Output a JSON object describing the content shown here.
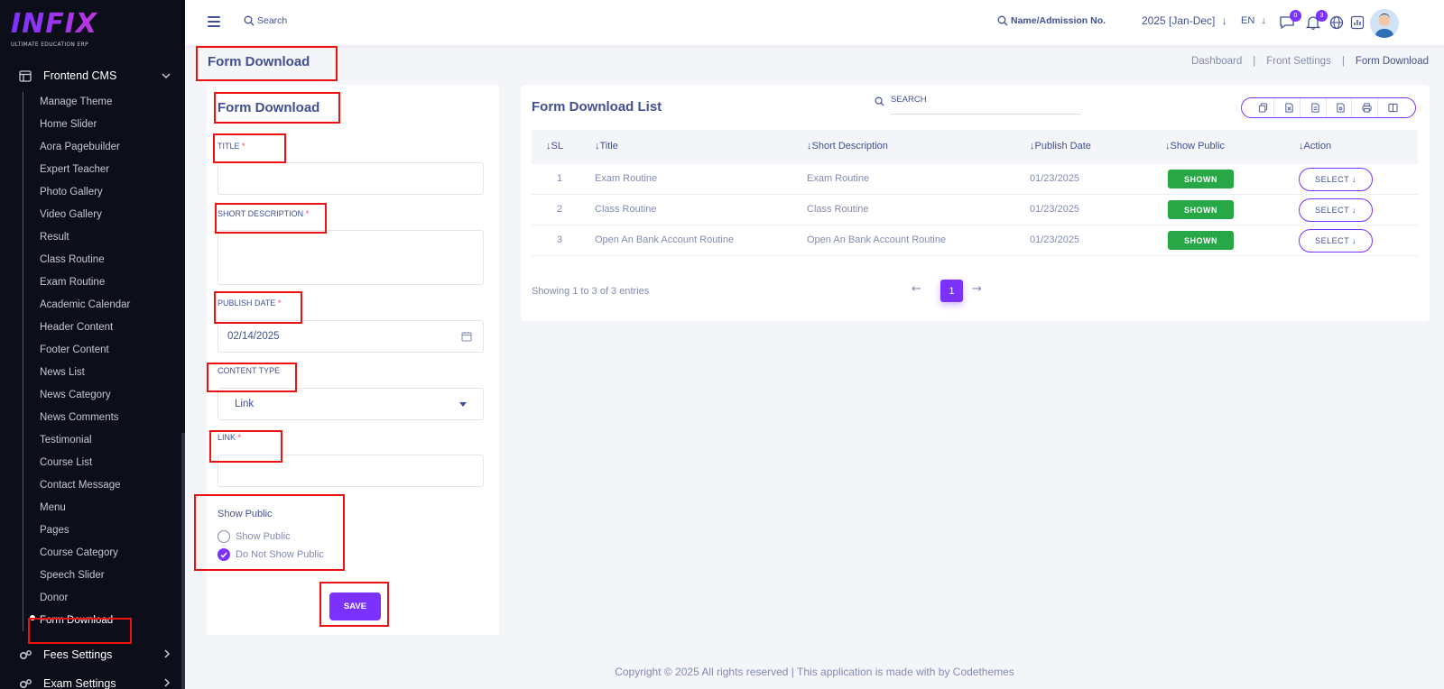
{
  "brand": {
    "logo_text": "INFIX",
    "logo_sub": "ULTIMATE EDUCATION ERP"
  },
  "sidebar": {
    "group_open": {
      "label": "Frontend CMS",
      "icon": "layout-icon"
    },
    "items": [
      "Manage Theme",
      "Home Slider",
      "Aora Pagebuilder",
      "Expert Teacher",
      "Photo Gallery",
      "Video Gallery",
      "Result",
      "Class Routine",
      "Exam Routine",
      "Academic Calendar",
      "Header Content",
      "Footer Content",
      "News List",
      "News Category",
      "News Comments",
      "Testimonial",
      "Course List",
      "Contact Message",
      "Menu",
      "Pages",
      "Course Category",
      "Speech Slider",
      "Donor",
      "Form Download"
    ],
    "active_item": "Form Download",
    "group_fees": {
      "label": "Fees Settings"
    },
    "group_exam": {
      "label": "Exam Settings"
    }
  },
  "header": {
    "search_placeholder": "Search",
    "admission_placeholder": "Name/Admission No.",
    "year": "2025 [Jan-Dec]",
    "lang": "EN",
    "messages_count": "0",
    "notifications_count": "3"
  },
  "page": {
    "title": "Form Download",
    "breadcrumb": [
      "Dashboard",
      "Front Settings",
      "Form Download"
    ]
  },
  "form": {
    "title": "Form Download",
    "title_label": "TITLE",
    "short_desc_label": "SHORT DESCRIPTION",
    "publish_date_label": "PUBLISH DATE",
    "publish_date_value": "02/14/2025",
    "content_type_label": "CONTENT TYPE",
    "content_type_value": "Link",
    "link_label": "LINK",
    "required_mark": "*",
    "show_public_title": "Show Public",
    "radio_show": "Show Public",
    "radio_hide": "Do Not Show Public",
    "selected_option": "Do Not Show Public",
    "save_label": "SAVE"
  },
  "list": {
    "title": "Form Download List",
    "search_placeholder": "SEARCH",
    "columns": [
      "SL",
      "Title",
      "Short Description",
      "Publish Date",
      "Show Public",
      "Action"
    ],
    "rows": [
      {
        "sl": "1",
        "title": "Exam Routine",
        "short": "Exam Routine",
        "date": "01/23/2025",
        "status": "SHOWN",
        "action": "SELECT"
      },
      {
        "sl": "2",
        "title": "Class Routine",
        "short": "Class Routine",
        "date": "01/23/2025",
        "status": "SHOWN",
        "action": "SELECT"
      },
      {
        "sl": "3",
        "title": "Open An Bank Account Routine",
        "short": "Open An Bank Account Routine",
        "date": "01/23/2025",
        "status": "SHOWN",
        "action": "SELECT"
      }
    ],
    "showing": "Showing 1 to 3 of 3 entries",
    "current_page": "1"
  },
  "footer": {
    "text": "Copyright © 2025 All rights reserved | This application is made with by Codethemes"
  },
  "colors": {
    "accent": "#7c32ff",
    "success": "#27a745",
    "annotation": "#f01010",
    "text": "#415094"
  }
}
